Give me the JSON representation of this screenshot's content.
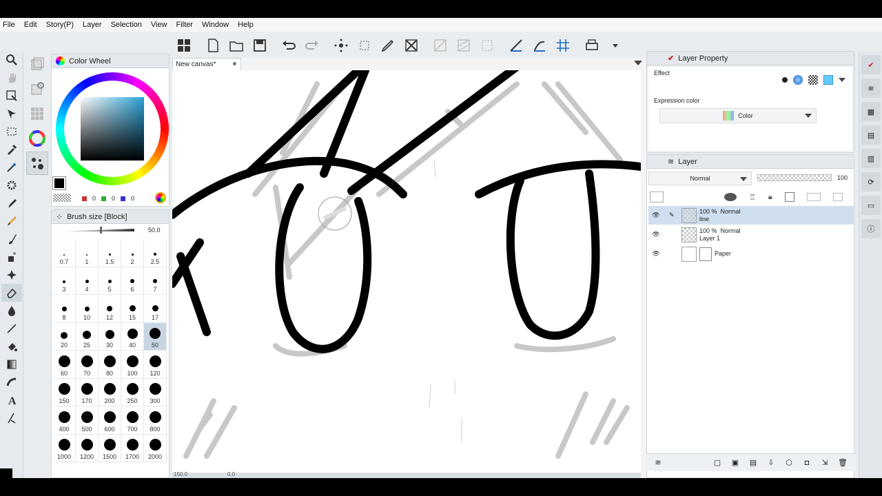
{
  "menu": [
    "File",
    "Edit",
    "Story(P)",
    "Layer",
    "Selection",
    "View",
    "Filter",
    "Window",
    "Help"
  ],
  "toolbar": [
    "grid-icon",
    "new-file-icon",
    "open-folder-icon",
    "save-icon",
    "undo-icon",
    "redo-icon",
    "transform-icon",
    "fit-icon",
    "pen-icon",
    "crop-icon",
    "ruler-icon",
    "perspective-icon",
    "rect-select-icon",
    "snap-line-icon",
    "snap-special-icon",
    "snap-grid-icon",
    "print-icon"
  ],
  "canvas": {
    "tab_title": "New canvas*"
  },
  "color_panel": {
    "title": "Color Wheel",
    "r": "0",
    "g": "0",
    "b": "0",
    "main_color": "#000000"
  },
  "brush_panel": {
    "title": "Brush size [Block]",
    "current": "50.0",
    "sizes": [
      "0.7",
      "1",
      "1.5",
      "2",
      "2.5",
      "3",
      "4",
      "5",
      "6",
      "7",
      "8",
      "10",
      "12",
      "15",
      "17",
      "20",
      "25",
      "30",
      "40",
      "50",
      "60",
      "70",
      "80",
      "100",
      "120",
      "150",
      "170",
      "200",
      "250",
      "300",
      "400",
      "500",
      "600",
      "700",
      "800",
      "1000",
      "1200",
      "1500",
      "1700",
      "2000"
    ],
    "selected": "50"
  },
  "layer_property": {
    "title": "Layer Property",
    "effect_label": "Effect",
    "expression_label": "Expression color",
    "expression_value": "Color"
  },
  "layer_panel": {
    "title": "Layer",
    "blend_mode": "Normal",
    "opacity": "100",
    "layers": [
      {
        "opacity": "100 %",
        "mode": "Normal",
        "name": "line",
        "selected": true
      },
      {
        "opacity": "100 %",
        "mode": "Normal",
        "name": "Layer 1",
        "selected": false
      },
      {
        "opacity": "",
        "mode": "",
        "name": "Paper",
        "selected": false
      }
    ]
  },
  "status": {
    "zoom": "150.0",
    "angle": "0.0"
  }
}
